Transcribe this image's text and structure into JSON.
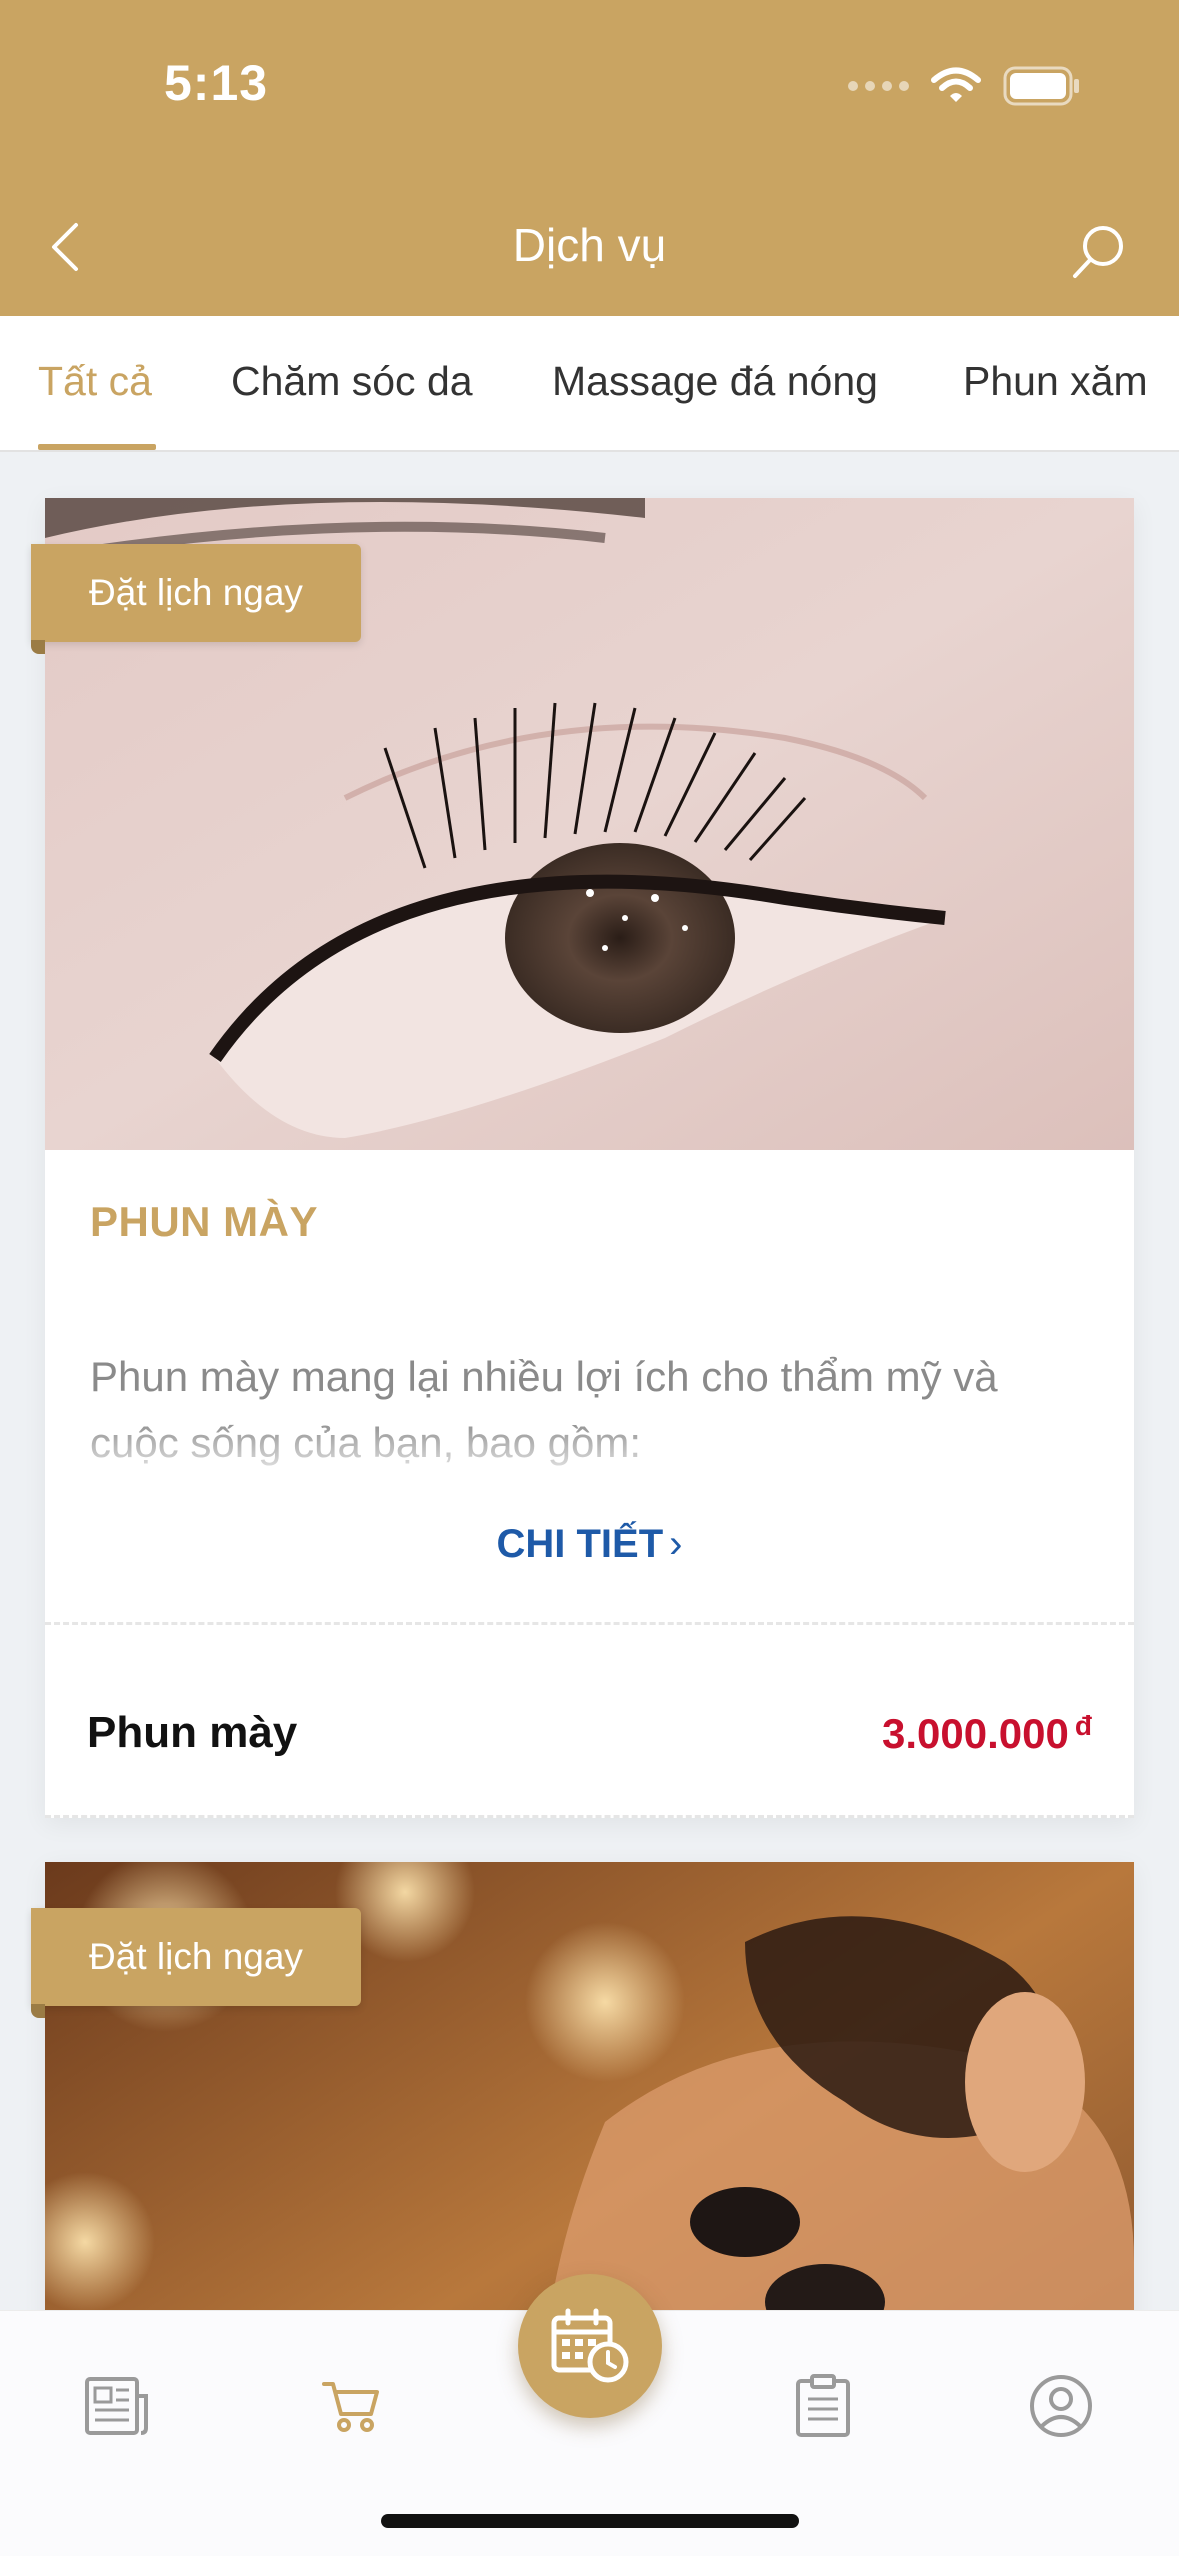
{
  "status_bar": {
    "time": "5:13"
  },
  "nav": {
    "title": "Dịch vụ",
    "back_icon": "chevron-left-icon",
    "search_icon": "search-icon"
  },
  "tabs": [
    {
      "label": "Tất cả",
      "active": true
    },
    {
      "label": "Chăm sóc da",
      "active": false
    },
    {
      "label": "Massage đá nóng",
      "active": false
    },
    {
      "label": "Phun xăm",
      "active": false
    }
  ],
  "cards": [
    {
      "badge": "Đặt lịch ngay",
      "title": "PHUN MÀY",
      "description": "Phun mày mang lại nhiều lợi ích cho thẩm mỹ và cuộc sống của bạn, bao gồm:",
      "detail_label": "CHI TIẾT",
      "price_name": "Phun mày",
      "price": "3.000.000",
      "currency": "đ"
    },
    {
      "badge": "Đặt lịch ngay"
    }
  ],
  "bottom_nav": [
    {
      "icon": "newspaper-icon",
      "active": false
    },
    {
      "icon": "cart-icon",
      "active": true
    },
    {
      "icon": "calendar-clock-icon",
      "active": false,
      "center": true
    },
    {
      "icon": "clipboard-list-icon",
      "active": false
    },
    {
      "icon": "user-circle-icon",
      "active": false
    }
  ],
  "colors": {
    "brand": "#c9a462",
    "link": "#1e5aa8",
    "price": "#c8102e"
  }
}
